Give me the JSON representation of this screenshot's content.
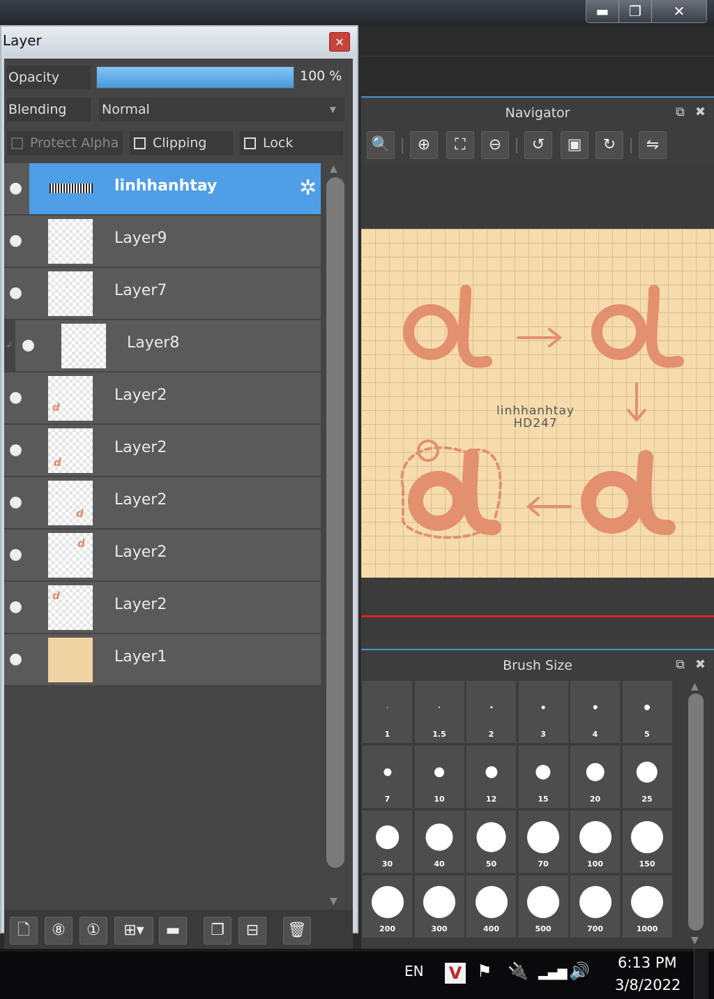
{
  "window": {
    "minimize": "▬",
    "maximize": "❐",
    "close": "✕"
  },
  "layer_panel": {
    "title": "Layer",
    "close_glyph": "✕",
    "opacity_label": "Opacity",
    "opacity_value": "100 %",
    "opacity_fraction": 1.0,
    "blending_label": "Blending",
    "blending_value": "Normal",
    "protect_alpha_label": "Protect Alpha",
    "clipping_label": "Clipping",
    "lock_label": "Lock",
    "layers": [
      {
        "name": "linhhanhtay",
        "selected": true
      },
      {
        "name": "Layer9"
      },
      {
        "name": "Layer7"
      },
      {
        "name": "Layer8",
        "clipped": true
      },
      {
        "name": "Layer2"
      },
      {
        "name": "Layer2"
      },
      {
        "name": "Layer2"
      },
      {
        "name": "Layer2"
      },
      {
        "name": "Layer2"
      },
      {
        "name": "Layer1"
      }
    ],
    "accent_color": "#4f9ee6"
  },
  "navigator": {
    "title": "Navigator",
    "canvas_text_line1": "linhhanhtay",
    "canvas_text_line2": "HD247"
  },
  "brush_size": {
    "title": "Brush Size",
    "sizes": [
      "1",
      "1.5",
      "2",
      "3",
      "4",
      "5",
      "7",
      "10",
      "12",
      "15",
      "20",
      "25",
      "30",
      "40",
      "50",
      "70",
      "100",
      "150",
      "200",
      "300",
      "400",
      "500",
      "700",
      "1000"
    ]
  },
  "taskbar": {
    "language": "EN",
    "time": "6:13 PM",
    "date": "3/8/2022",
    "v_icon": "V"
  }
}
